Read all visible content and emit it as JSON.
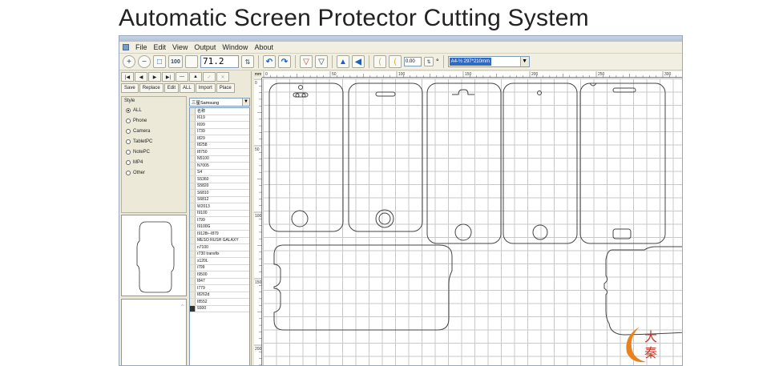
{
  "banner": {
    "title": "Automatic Screen Protector Cutting System"
  },
  "window": {
    "title": ""
  },
  "menu": {
    "items": [
      "File",
      "Edit",
      "View",
      "Output",
      "Window",
      "About"
    ]
  },
  "toolbar": {
    "text_button": "100",
    "zoom_value": "71.2",
    "small_value": "0.00",
    "degree_symbol": "°",
    "paper_size": "A4-½ 297*210mm"
  },
  "nav": {
    "buttons": [
      "|◀",
      "◀",
      "▶",
      "▶|",
      "—",
      "▲",
      "✓",
      "✕"
    ]
  },
  "actions": [
    "Save",
    "Replace",
    "Edit",
    "ALL",
    "Import",
    "Place"
  ],
  "style": {
    "title": "Style",
    "options": [
      "ALL",
      "Phone",
      "Camera",
      "TabletPC",
      "NotePC",
      "MP4",
      "Other"
    ],
    "selected": "ALL"
  },
  "models": {
    "combo_value": "三星Samsung",
    "header": "名称",
    "items": [
      "I619",
      "I699",
      "I739",
      "I829",
      "I8258",
      "I8750",
      "N5100",
      "N7005",
      "S4",
      "S5360",
      "S5820",
      "S6810",
      "S6812",
      "W2013",
      "I9100",
      "I799",
      "I9100G",
      "I9128i--I879",
      "MESO RUSH GALAXY",
      "n7100",
      "r730 transfix",
      "s120L",
      "i799",
      "I9500",
      "I847",
      "I779",
      "I8262d",
      "I8552",
      "9300"
    ]
  },
  "ruler": {
    "corner": "mm",
    "top_labels": [
      "0",
      "50",
      "100",
      "150",
      "200",
      "250",
      "300"
    ],
    "left_labels": [
      "0",
      "50",
      "100",
      "150",
      "200"
    ]
  },
  "colors": {
    "accent": "#316ac5",
    "logo_orange": "#e8821e"
  },
  "logo": {
    "chars": [
      "大",
      "秦"
    ],
    "icon": "crescent-logo-icon"
  }
}
